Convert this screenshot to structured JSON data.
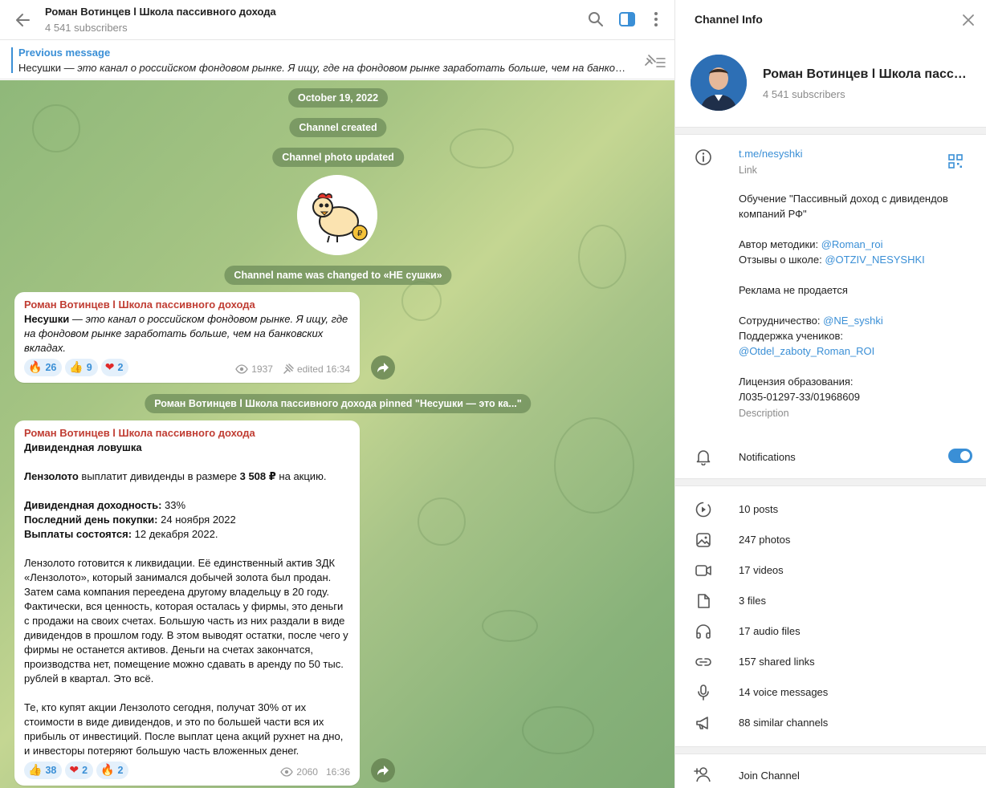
{
  "header": {
    "title": "Роман Вотинцев l Школа пассивного дохода",
    "subscribers": "4 541 subscribers"
  },
  "pinned": {
    "label": "Previous message",
    "text_bold": "Несушки",
    "text_rest": " — это канал о российском фондовом рынке. Я ищу, где на фондовом рынке заработать больше, чем на банковск..."
  },
  "service": {
    "date": "October 19, 2022",
    "created": "Channel created",
    "photo_updated": "Channel photo updated",
    "name_changed": "Channel name was changed to «НЕ сушки»",
    "pinned_notice": "Роман Вотинцев l Школа пассивного дохода pinned \"Несушки — это ка...\""
  },
  "messages": [
    {
      "author": "Роман Вотинцев l Школа пассивного дохода",
      "text_bold": "Несушки",
      "text_rest": " — это канал о российском фондовом рынке. Я ищу, где на фондовом рынке заработать больше, чем на банковских вкладах.",
      "reactions": [
        {
          "emoji": "🔥",
          "count": "26"
        },
        {
          "emoji": "👍",
          "count": "9"
        },
        {
          "emoji": "❤",
          "count": "2"
        }
      ],
      "views": "1937",
      "time": "edited 16:34"
    },
    {
      "author": "Роман Вотинцев l Школа пассивного дохода",
      "title": "Дивидендная ловушка",
      "line1_bold": "Лензолото",
      "line1_mid": " выплатит дивиденды в размере ",
      "line1_bold2": "3 508 ₽",
      "line1_end": " на акцию.",
      "yield_label": "Дивидендная доходность:",
      "yield_value": " 33%",
      "lastday_label": "Последний день покупки:",
      "lastday_value": " 24 ноября 2022",
      "payout_label": "Выплаты состоятся:",
      "payout_value": " 12 декабря 2022.",
      "para1": "Лензолото готовится к ликвидации. Её единственный актив ЗДК «Лензолото», который занимался добычей золота был продан. Затем сама компания переедена другому владельцу в 20 году. Фактически, вся ценность, которая осталась у фирмы, это деньги с продажи на своих счетах. Большую часть из них раздали в виде дивидендов в прошлом году. В этом выводят остатки, после чего у фирмы не останется активов. Деньги на счетах закончатся, производства нет, помещение можно сдавать в аренду по 50 тыс. рублей в квартал. Это всё.",
      "para2": "Те, кто купят акции Лензолото сегодня, получат 30% от их стоимости в виде дивидендов, и это по большей части вся их прибыль от инвестиций. После выплат цена акций рухнет на дно, и инвесторы потеряют большую часть вложенных денег.",
      "reactions": [
        {
          "emoji": "👍",
          "count": "38"
        },
        {
          "emoji": "❤",
          "count": "2"
        },
        {
          "emoji": "🔥",
          "count": "2"
        }
      ],
      "views": "2060",
      "time": "16:36"
    }
  ],
  "panel": {
    "title": "Channel Info",
    "name": "Роман Вотинцев l Школа пассивного дохода",
    "subscribers": "4 541 subscribers",
    "link": "t.me/nesyshki",
    "link_caption": "Link",
    "desc_line1": "Обучение \"Пассивный доход с дивидендов компаний РФ\"",
    "desc_author_label": "Автор методики: ",
    "desc_author_link": "@Roman_roi",
    "desc_reviews_label": "Отзывы о школе: ",
    "desc_reviews_link": "@OTZIV_NESYSHKI",
    "desc_ads": "Реклама не продается",
    "desc_coop_label": "Сотрудничество: ",
    "desc_coop_link": "@NE_syshki",
    "desc_support_label": "Поддержка учеников:",
    "desc_support_link": "@Otdel_zaboty_Roman_ROI",
    "desc_license_label": "Лицензия образования:",
    "desc_license_value": "Л035-01297-33/01968609",
    "desc_caption": "Description",
    "notifications": "Notifications",
    "notifications_on": true,
    "media": [
      {
        "icon": "posts-icon",
        "label": "10 posts"
      },
      {
        "icon": "photos-icon",
        "label": "247 photos"
      },
      {
        "icon": "videos-icon",
        "label": "17 videos"
      },
      {
        "icon": "files-icon",
        "label": "3 files"
      },
      {
        "icon": "audio-icon",
        "label": "17 audio files"
      },
      {
        "icon": "link-icon",
        "label": "157 shared links"
      },
      {
        "icon": "voice-icon",
        "label": "14 voice messages"
      },
      {
        "icon": "megaphone-icon",
        "label": "88 similar channels"
      }
    ],
    "join": "Join Channel"
  },
  "colors": {
    "accent": "#3a8fd6",
    "author": "#c03d33",
    "reaction_bg": "#e4f0fb"
  }
}
